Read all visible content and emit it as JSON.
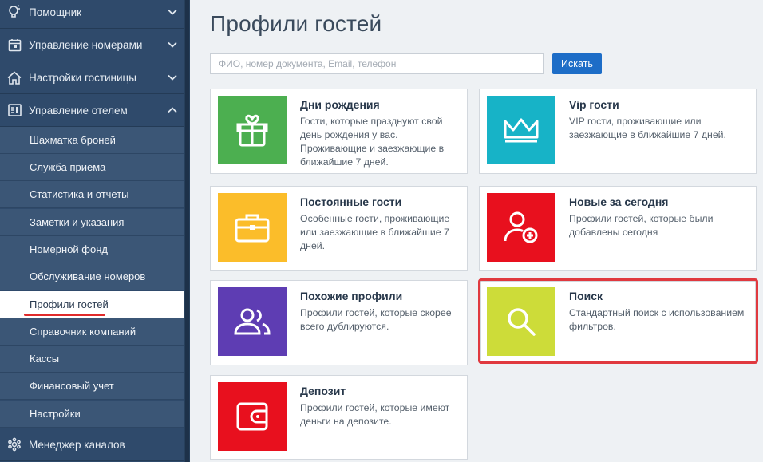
{
  "sidebar": {
    "sections": [
      {
        "label": "Помощник",
        "icon": "lightbulb-icon",
        "chevron": "chevron-down-icon"
      },
      {
        "label": "Управление номерами",
        "icon": "calendar-icon",
        "chevron": "chevron-down-icon"
      },
      {
        "label": "Настройки гостиницы",
        "icon": "home-icon",
        "chevron": "chevron-down-icon"
      },
      {
        "label": "Управление отелем",
        "icon": "dashboard-icon",
        "chevron": "chevron-up-icon"
      }
    ],
    "items": [
      {
        "label": "Шахматка броней"
      },
      {
        "label": "Служба приема"
      },
      {
        "label": "Статистика и отчеты"
      },
      {
        "label": "Заметки и указания"
      },
      {
        "label": "Номерной фонд"
      },
      {
        "label": "Обслуживание номеров"
      },
      {
        "label": "Профили гостей",
        "active": true
      },
      {
        "label": "Справочник компаний"
      },
      {
        "label": "Кассы"
      },
      {
        "label": "Финансовый учет"
      },
      {
        "label": "Настройки"
      }
    ],
    "footer": {
      "label": "Менеджер каналов",
      "icon": "gear-cog-icon"
    }
  },
  "main": {
    "title": "Профили гостей",
    "search": {
      "placeholder": "ФИО, номер документа, Email, телефон",
      "value": "",
      "button": "Искать"
    },
    "cards": [
      {
        "title": "Дни рождения",
        "description": "Гости, которые празднуют свой день рождения у вас. Проживающие и заезжающие в ближайшие 7 дней.",
        "color": "#4caf50",
        "icon": "gift-icon"
      },
      {
        "title": "Vip гости",
        "description": "VIP гости, проживающие или заезжающие в ближайшие 7 дней.",
        "color": "#17b3c7",
        "icon": "crown-icon"
      },
      {
        "title": "Постоянные гости",
        "description": "Особенные гости, проживающие или заезжающие в ближайшие 7 дней.",
        "color": "#fbbd2a",
        "icon": "briefcase-icon"
      },
      {
        "title": "Новые за сегодня",
        "description": "Профили гостей, которые были добавлены сегодня",
        "color": "#e8101e",
        "icon": "add-user-icon"
      },
      {
        "title": "Похожие профили",
        "description": "Профили гостей, которые скорее всего дублируются.",
        "color": "#5e3db3",
        "icon": "users-icon"
      },
      {
        "title": "Поиск",
        "description": "Стандартный поиск с использованием фильтров.",
        "color": "#cddc39",
        "icon": "search-icon"
      },
      {
        "title": "Депозит",
        "description": "Профили гостей, которые имеют деньги на депозите.",
        "color": "#e8101e",
        "icon": "wallet-icon"
      }
    ]
  }
}
